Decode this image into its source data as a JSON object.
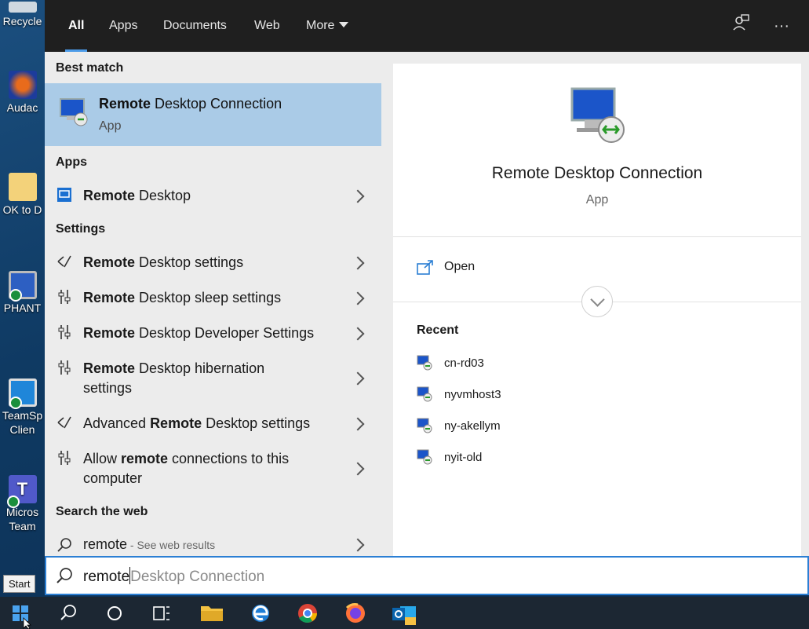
{
  "tabs": [
    {
      "label": "All",
      "active": true
    },
    {
      "label": "Apps"
    },
    {
      "label": "Documents"
    },
    {
      "label": "Web"
    },
    {
      "label": "More"
    }
  ],
  "desktop_icons": [
    {
      "label": "Recycle",
      "icon": "recycle-bin-icon"
    },
    {
      "label": "Audac",
      "icon": "audacity-icon"
    },
    {
      "label": "OK to D",
      "icon": "folder-icon"
    },
    {
      "label": "PHANT",
      "icon": "monitor-icon"
    },
    {
      "label": "TeamSp",
      "label2": "Clien",
      "icon": "teamspeak-icon"
    },
    {
      "label": "Micros",
      "label2": "Team",
      "icon": "teams-icon"
    }
  ],
  "sections": {
    "best_match": "Best match",
    "apps": "Apps",
    "settings": "Settings",
    "search_web": "Search the web"
  },
  "best_match": {
    "bold": "Remote",
    "rest": " Desktop Connection",
    "type": "App"
  },
  "apps": [
    {
      "bold": "Remote",
      "rest": " Desktop"
    }
  ],
  "settings": [
    {
      "pre": "",
      "bold": "Remote",
      "rest": " Desktop settings"
    },
    {
      "pre": "",
      "bold": "Remote",
      "rest": " Desktop sleep settings"
    },
    {
      "pre": "",
      "bold": "Remote",
      "rest": " Desktop Developer Settings"
    },
    {
      "pre": "",
      "bold": "Remote",
      "rest": " Desktop hibernation",
      "line2": "settings"
    },
    {
      "pre": "Advanced ",
      "bold": "Remote",
      "rest": " Desktop settings"
    },
    {
      "pre": "Allow ",
      "bold": "remote",
      "rest": " connections to this",
      "line2": "computer"
    }
  ],
  "web": {
    "query": "remote",
    "suffix": " - See web results"
  },
  "detail": {
    "name": "Remote Desktop Connection",
    "type": "App",
    "open_label": "Open",
    "recent_heading": "Recent",
    "recent": [
      "cn-rd03",
      "nyvmhost3",
      "ny-akellym",
      "nyit-old"
    ]
  },
  "search": {
    "typed": "remote",
    "ghost": "Desktop Connection"
  },
  "start_tooltip": "Start",
  "colors": {
    "accent": "#2b7fd4",
    "selection": "#aacbe7",
    "topbar": "#1f1f1f",
    "taskbar": "#1c2733"
  }
}
